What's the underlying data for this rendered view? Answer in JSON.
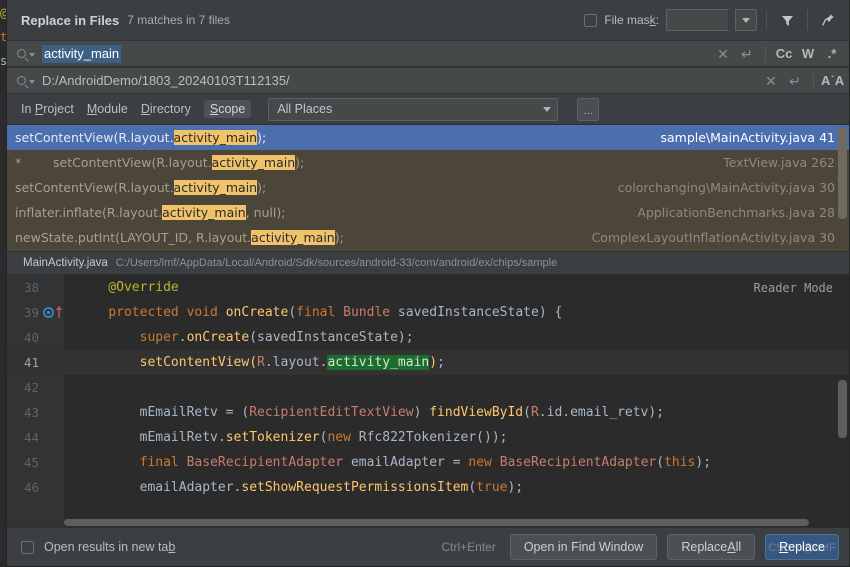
{
  "window": {
    "title": "Replace in Files",
    "match_summary": "7 matches in 7 files"
  },
  "header": {
    "file_mask_label_pre": "File mas",
    "file_mask_label_key": "k",
    "file_mask_label_post": ":",
    "file_mask_value": "",
    "filter_icon": "filter-icon",
    "pin_icon": "pin-icon"
  },
  "search": {
    "value": "activity_main",
    "placeholder": "",
    "clear_icon": "close-icon",
    "history_icon": "revert-icon",
    "toggles": [
      {
        "name": "match-case",
        "label": "Cc"
      },
      {
        "name": "words",
        "label": "W"
      },
      {
        "name": "regex",
        "label": ".*"
      }
    ]
  },
  "replace": {
    "value": "D:/AndroidDemo/1803_20240103T112135/",
    "clear_icon": "close-icon",
    "history_icon": "revert-icon",
    "preserve_case_label": "A˙A"
  },
  "scope": {
    "links": [
      {
        "name": "in-project",
        "pre": "In ",
        "key": "P",
        "post": "roject",
        "active": false
      },
      {
        "name": "module",
        "pre": "",
        "key": "M",
        "post": "odule",
        "active": false
      },
      {
        "name": "directory",
        "pre": "",
        "key": "D",
        "post": "irectory",
        "active": false
      },
      {
        "name": "scope",
        "pre": "",
        "key": "S",
        "post": "cope",
        "active": true
      }
    ],
    "selected": "All Places",
    "ellipsis_label": "..."
  },
  "results": [
    {
      "selected": true,
      "comment": false,
      "prefix": "setContentView(R.layout.",
      "match": "activity_main",
      "suffix": ");",
      "file": "sample\\MainActivity.java",
      "line": "41"
    },
    {
      "selected": false,
      "comment": true,
      "star": "*",
      "prefix": "setContentView(R.layout.",
      "match": "activity_main",
      "suffix": ");",
      "file": "TextView.java",
      "line": "262"
    },
    {
      "selected": false,
      "comment": false,
      "prefix": "setContentView(R.layout.",
      "match": "activity_main",
      "suffix": ");",
      "file": "colorchanging\\MainActivity.java",
      "line": "30"
    },
    {
      "selected": false,
      "comment": false,
      "prefix": "inflater.inflate(R.layout.",
      "match": "activity_main",
      "suffix": ", null);",
      "file": "ApplicationBenchmarks.java",
      "line": "28"
    },
    {
      "selected": false,
      "comment": false,
      "prefix": "newState.putInt(LAYOUT_ID, R.layout.",
      "match": "activity_main",
      "suffix": ");",
      "file": "ComplexLayoutInflationActivity.java",
      "line": "30"
    }
  ],
  "preview": {
    "file_name": "MainActivity.java",
    "file_path": "C:/Users/lmf/AppData/Local/Android/Sdk/sources/android-33/com/android/ex/chips/sample",
    "reader_mode": "Reader Mode",
    "lines": [
      {
        "num": "38",
        "current": false,
        "gutter": ""
      },
      {
        "num": "39",
        "current": false,
        "gutter": "override-marker"
      },
      {
        "num": "40",
        "current": false,
        "gutter": ""
      },
      {
        "num": "41",
        "current": true,
        "gutter": ""
      },
      {
        "num": "42",
        "current": false,
        "gutter": ""
      },
      {
        "num": "43",
        "current": false,
        "gutter": ""
      },
      {
        "num": "44",
        "current": false,
        "gutter": ""
      },
      {
        "num": "45",
        "current": false,
        "gutter": ""
      },
      {
        "num": "46",
        "current": false,
        "gutter": ""
      }
    ],
    "code_text": [
      "    @Override",
      "    protected void onCreate(final Bundle savedInstanceState) {",
      "        super.onCreate(savedInstanceState);",
      "        setContentView(R.layout.activity_main);",
      "",
      "        mEmailRetv = (RecipientEditTextView) findViewById(R.id.email_retv);",
      "        mEmailRetv.setTokenizer(new Rfc822Tokenizer());",
      "        final BaseRecipientAdapter emailAdapter = new BaseRecipientAdapter(this);",
      "        emailAdapter.setShowRequestPermissionsItem(true);"
    ]
  },
  "footer": {
    "open_new_tab_pre": "Open results in new ta",
    "open_new_tab_key": "b",
    "shortcut": "Ctrl+Enter",
    "open_find_window": "Open in Find Window",
    "replace_all_pre": "Replace ",
    "replace_all_key": "A",
    "replace_all_post": "ll",
    "replace_pre": "",
    "replace_key": "R",
    "replace_post": "eplace",
    "watermark": "CSDN @LMF"
  },
  "colors": {
    "dialog_bg": "#3c3f41",
    "field_bg": "#45494a",
    "selection_blue": "#4b6eaf",
    "results_bg": "#4b4639",
    "match_highlight": "#f0c36b",
    "editor_bg": "#2b2b2b",
    "primary_button": "#365880",
    "find_highlight": "#1a6d2b"
  }
}
